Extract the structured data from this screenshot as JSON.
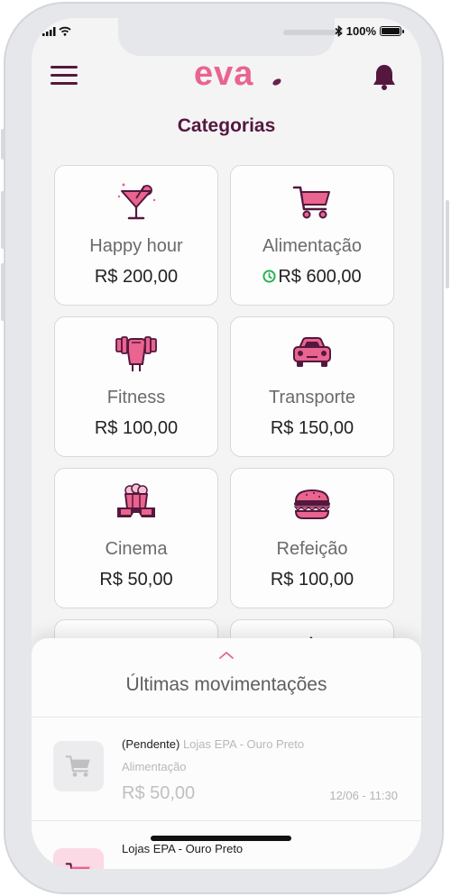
{
  "status_bar": {
    "battery": "100%"
  },
  "header": {
    "logo": "eva"
  },
  "page_title": "Categorias",
  "categories": [
    {
      "label": "Happy hour",
      "amount": "R$ 200,00",
      "icon": "cocktail-icon",
      "pending": false
    },
    {
      "label": "Alimentação",
      "amount": "R$ 600,00",
      "icon": "shopping-cart-icon",
      "pending": true
    },
    {
      "label": "Fitness",
      "amount": "R$ 100,00",
      "icon": "dumbbell-icon",
      "pending": false
    },
    {
      "label": "Transporte",
      "amount": "R$ 150,00",
      "icon": "car-icon",
      "pending": false
    },
    {
      "label": "Cinema",
      "amount": "R$ 50,00",
      "icon": "popcorn-3d-glasses-icon",
      "pending": false
    },
    {
      "label": "Refeição",
      "amount": "R$ 100,00",
      "icon": "burger-icon",
      "pending": false
    }
  ],
  "movements": {
    "title": "Últimas movimentações",
    "items": [
      {
        "status": "(Pendente)",
        "merchant": "Lojas EPA - Ouro Preto",
        "category": "Alimentação",
        "amount": "R$ 50,00",
        "date": "12/06 - 11:30",
        "icon": "shopping-cart-icon"
      },
      {
        "status": "",
        "merchant": "Lojas EPA - Ouro Preto",
        "category": "",
        "amount": "",
        "date": "",
        "icon": "shopping-cart-icon"
      }
    ]
  },
  "colors": {
    "brand_pink": "#e9648e",
    "brand_purple": "#54183f",
    "pending_green": "#1fb24a"
  }
}
